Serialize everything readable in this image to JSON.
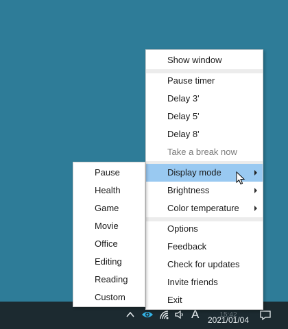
{
  "main_menu": {
    "items": [
      {
        "label": "Show window"
      },
      {
        "label": "Pause timer"
      },
      {
        "label": "Delay 3'"
      },
      {
        "label": "Delay 5'"
      },
      {
        "label": "Delay 8'"
      },
      {
        "label": "Take a break now"
      },
      {
        "label": "Display mode"
      },
      {
        "label": "Brightness"
      },
      {
        "label": "Color temperature"
      },
      {
        "label": "Options"
      },
      {
        "label": "Feedback"
      },
      {
        "label": "Check for updates"
      },
      {
        "label": "Invite friends"
      },
      {
        "label": "Exit"
      }
    ]
  },
  "sub_menu": {
    "items": [
      {
        "label": "Pause"
      },
      {
        "label": "Health"
      },
      {
        "label": "Game"
      },
      {
        "label": "Movie"
      },
      {
        "label": "Office"
      },
      {
        "label": "Editing"
      },
      {
        "label": "Reading"
      },
      {
        "label": "Custom"
      }
    ]
  },
  "taskbar": {
    "time_text": "15:42",
    "date_text": "2021/01/04",
    "input_indicator": "A",
    "icons": [
      "chevron-up-icon",
      "eye-icon",
      "wifi-icon",
      "speaker-icon",
      "notification-icon"
    ]
  },
  "colors": {
    "desktop": "#2e7c98",
    "taskbar": "#1c2a30",
    "highlight": "#99c9f1",
    "eye_icon": "#33b3e6"
  }
}
